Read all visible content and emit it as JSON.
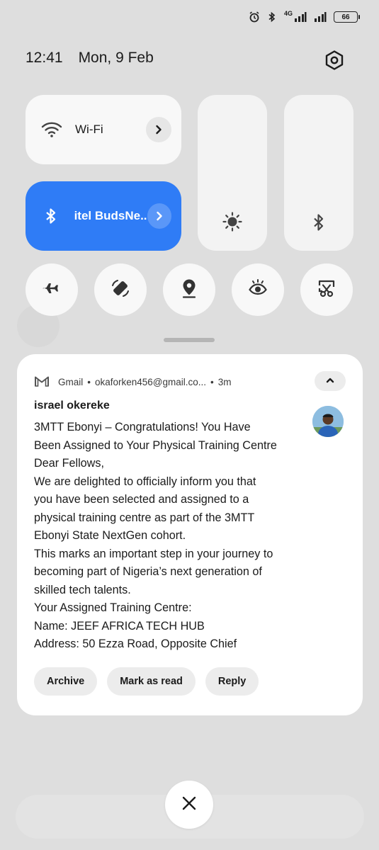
{
  "status_bar": {
    "network_label": "4G",
    "battery_level": "66",
    "icons": [
      "alarm-icon",
      "bluetooth-icon",
      "signal-icon",
      "signal-icon",
      "battery-icon"
    ]
  },
  "header": {
    "time": "12:41",
    "date": "Mon, 9 Feb"
  },
  "quick_settings": {
    "wifi": {
      "label": "Wi-Fi",
      "icon": "wifi-icon"
    },
    "bluetooth": {
      "label": "itel BudsNe..",
      "icon": "bluetooth-icon",
      "active_color": "#2f7cf6"
    },
    "sliders": [
      {
        "name": "brightness",
        "icon": "sun-icon"
      },
      {
        "name": "volume",
        "icon": "bluetooth-icon"
      }
    ],
    "toggles": [
      "airplane-icon",
      "auto-rotate-icon",
      "location-icon",
      "eye-comfort-icon",
      "screenshot-icon"
    ]
  },
  "notification": {
    "app": "Gmail",
    "account": "okaforken456@gmail.co...",
    "age": "3m",
    "sender": "israel okereke",
    "lines": [
      "3MTT Ebonyi – Congratulations! You Have",
      "Been Assigned to Your Physical Training Centre",
      "Dear Fellows,",
      "We are delighted to officially inform you that",
      "you have been selected and assigned to a",
      "physical training centre as part of the 3MTT",
      "Ebonyi State NextGen cohort.",
      "This marks an important step in your journey to",
      "becoming part of Nigeria’s next generation of",
      "skilled tech talents.",
      "Your Assigned Training Centre:",
      "Name: JEEF AFRICA TECH HUB",
      "Address: 50 Ezza Road, Opposite Chief"
    ],
    "actions": {
      "archive": "Archive",
      "mark_read": "Mark as read",
      "reply": "Reply"
    }
  }
}
